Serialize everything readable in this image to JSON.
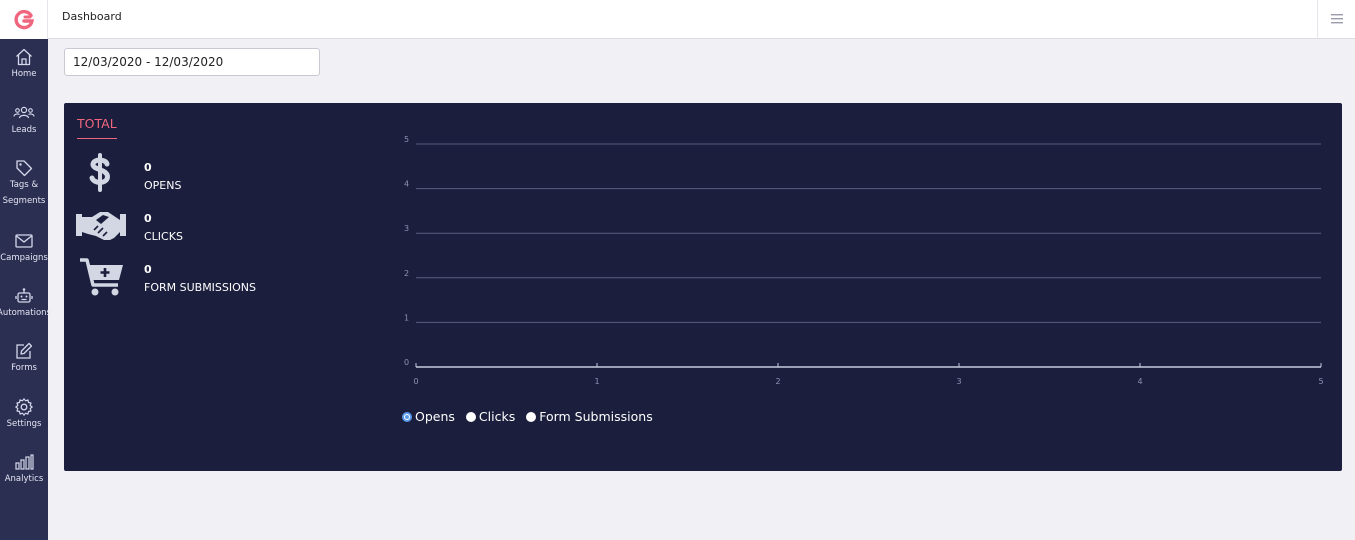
{
  "header": {
    "title": "Dashboard",
    "logo": "g-logo",
    "menu_icon": "hamburger-icon",
    "brand_color": "#f1667f"
  },
  "sidebar": {
    "items": [
      {
        "label": "Home",
        "icon": "home-icon"
      },
      {
        "label": "Leads",
        "icon": "users-icon"
      },
      {
        "label_line1": "Tags &",
        "label_line2": "Segments",
        "icon": "tag-icon"
      },
      {
        "label": "Campaigns",
        "icon": "envelope-icon"
      },
      {
        "label": "Automations",
        "icon": "robot-icon"
      },
      {
        "label": "Forms",
        "icon": "edit-icon"
      },
      {
        "label": "Settings",
        "icon": "gear-icon"
      },
      {
        "label": "Analytics",
        "icon": "bar-chart-icon"
      }
    ]
  },
  "filters": {
    "date_range": "12/03/2020 - 12/03/2020"
  },
  "panel": {
    "tab": "TOTAL",
    "stats": [
      {
        "value": "0",
        "label": "OPENS",
        "icon": "dollar-icon"
      },
      {
        "value": "0",
        "label": "CLICKS",
        "icon": "handshake-icon"
      },
      {
        "value": "0",
        "label": "FORM SUBMISSIONS",
        "icon": "cart-plus-icon"
      }
    ]
  },
  "legend": {
    "items": [
      {
        "label": "Opens",
        "checked": true
      },
      {
        "label": "Clicks",
        "checked": false
      },
      {
        "label": "Form Submissions",
        "checked": false
      }
    ]
  },
  "chart_data": {
    "type": "line",
    "x_ticks": [
      "0",
      "1",
      "2",
      "3",
      "4",
      "5"
    ],
    "y_ticks": [
      "0",
      "1",
      "2",
      "3",
      "4",
      "5"
    ],
    "xlim": [
      0,
      5
    ],
    "ylim": [
      0,
      5
    ],
    "grid": true,
    "legend_position": "bottom-left",
    "series": []
  }
}
